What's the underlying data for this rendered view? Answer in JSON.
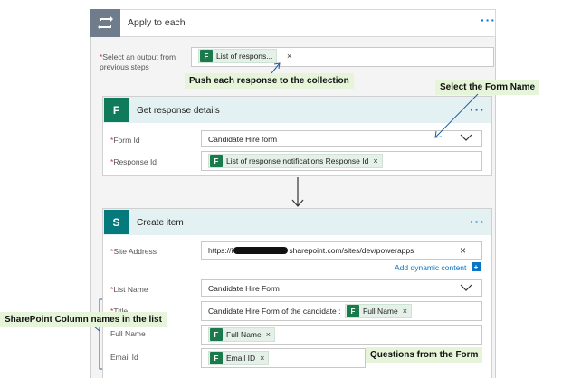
{
  "apply": {
    "title": "Apply to each",
    "select_label": "Select an output from previous steps",
    "select_token": "List of respons...",
    "more": "···"
  },
  "annotations": {
    "push": "Push each response to the collection",
    "select_form": "Select the Form Name",
    "sp_columns": "SharePoint Column names in the list",
    "questions": "Questions from the Form"
  },
  "get_details": {
    "title": "Get response details",
    "more": "···",
    "form_id_label": "Form Id",
    "form_id_value": "Candidate Hire form",
    "response_id_label": "Response Id",
    "response_id_token": "List of response notifications Response Id"
  },
  "create_item": {
    "title": "Create item",
    "more": "···",
    "site_label": "Site Address",
    "site_value_prefix": "https://i",
    "site_value_suffix": "sharepoint.com/sites/dev/powerapps",
    "add_dynamic": "Add dynamic content",
    "list_label": "List Name",
    "list_value": "Candidate Hire Form",
    "title_label": "Title",
    "title_value": "Candidate Hire Form of the candidate :",
    "title_token": "Full Name",
    "fullname_label": "Full Name",
    "fullname_token": "Full Name",
    "email_label": "Email Id",
    "email_token": "Email ID"
  },
  "glyphs": {
    "required": "*",
    "close": "×",
    "chevron": "⌵",
    "forms_letter": "F",
    "sp_letter": "S",
    "plus": "+"
  },
  "colors": {
    "accent": "#0a75c4",
    "annotation_bg": "#e6f4d9",
    "forms_green": "#0f7b5a",
    "sharepoint_teal": "#047a7c",
    "header_slate": "#6f7c8b"
  }
}
